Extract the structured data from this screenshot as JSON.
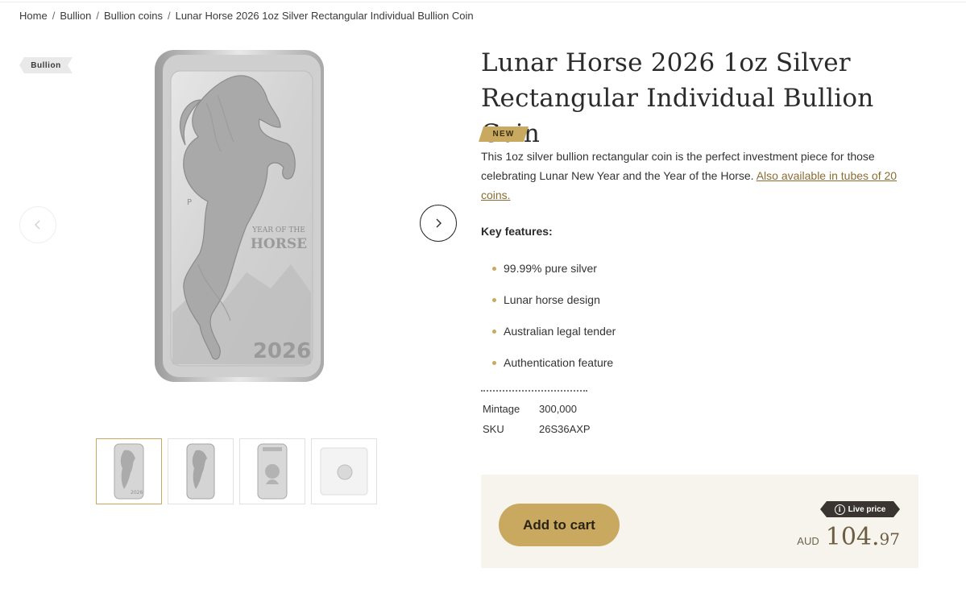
{
  "breadcrumb": {
    "items": [
      "Home",
      "Bullion",
      "Bullion coins",
      "Lunar Horse 2026 1oz Silver Rectangular Individual Bullion Coin"
    ],
    "separator": "/"
  },
  "category_tag": "Bullion",
  "coin_image": {
    "inscription_line1": "YEAR OF THE",
    "inscription_line2": "HORSE",
    "year": "2026",
    "mint_mark": "P"
  },
  "thumbnails": [
    {
      "icon": "coin-reverse-front-icon",
      "active": true
    },
    {
      "icon": "coin-reverse-angle-icon",
      "active": false
    },
    {
      "icon": "coin-obverse-icon",
      "active": false
    },
    {
      "icon": "coin-packaging-icon",
      "active": false
    }
  ],
  "product": {
    "title": "Lunar Horse 2026 1oz Silver Rectangular Individual Bullion Coin",
    "badge": "NEW",
    "description": "This 1oz silver bullion rectangular coin is the perfect investment piece for those celebrating Lunar New Year and the Year of the Horse.",
    "link_text": "Also available in tubes of 20 coins.",
    "key_features_title": "Key features:",
    "features": [
      "99.99% pure silver",
      "Lunar horse design",
      "Australian legal tender",
      "Authentication feature"
    ],
    "specs": [
      {
        "label": "Mintage",
        "value": "300,000"
      },
      {
        "label": "SKU",
        "value": "26S36AXP"
      }
    ]
  },
  "purchase": {
    "add_to_cart": "Add to cart",
    "live_price_label": "Live price",
    "currency": "AUD",
    "price_main": "104.",
    "price_cents": "97"
  },
  "colors": {
    "accent_gold": "#c8a95f",
    "box_bg": "#f7f4ee",
    "live_tag_bg": "#3a3530"
  }
}
